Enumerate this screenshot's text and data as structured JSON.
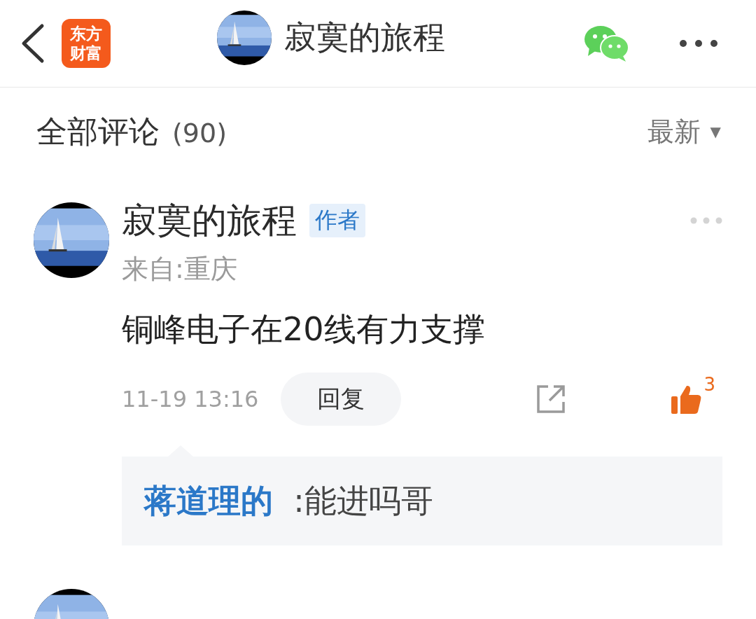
{
  "header": {
    "logo_lines": [
      "东方",
      "财富"
    ],
    "title": "寂寞的旅程"
  },
  "comments_header": {
    "title": "全部评论",
    "count": "(90)",
    "sort": "最新",
    "sort_caret": "▼"
  },
  "comments": [
    {
      "author": "寂寞的旅程",
      "badge": "作者",
      "location": "来自:重庆",
      "text": "铜峰电子在20线有力支撑",
      "time": "11-19 13:16",
      "reply_button": "回复",
      "likes": "3",
      "liked": true,
      "replies": [
        {
          "author": "蒋道理的",
          "text": " :能进吗哥"
        }
      ]
    }
  ]
}
